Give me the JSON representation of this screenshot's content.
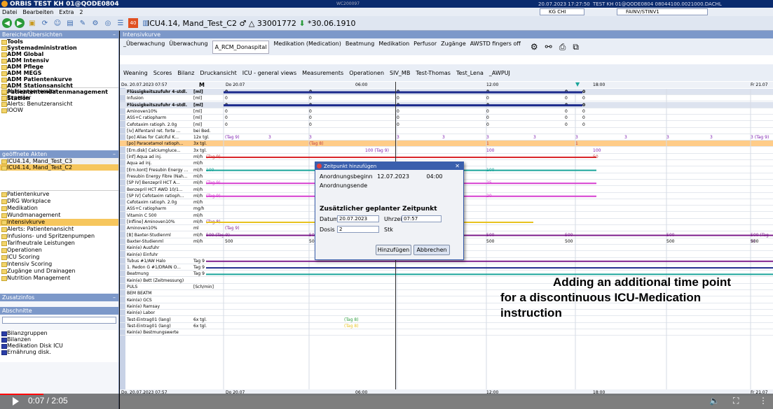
{
  "window": {
    "title": "ORBIS TEST KH 01@QODE0804",
    "center_text": "WC200097",
    "time": "20.07.2023 17:27:50",
    "right_text": "TEST KH 01@QODE0804 08044100.0021000.DACHL"
  },
  "menu": {
    "items": [
      "Datei",
      "Bearbeiten",
      "Extra",
      "2"
    ],
    "kg": "KG CHI",
    "fainv": "FAINV/STINV1"
  },
  "toolbar": {
    "patient": "ICU4.14, Mand_Test_C2",
    "patient_id": "33001772",
    "birth": "*30.06.1910"
  },
  "sidebar": {
    "section1_title": "Bereiche/Übersichten",
    "items1": [
      {
        "label": "Tools",
        "bold": true
      },
      {
        "label": "Systemadministration",
        "bold": true
      },
      {
        "label": "ADM Global",
        "bold": true
      },
      {
        "label": "ADM Intensiv",
        "bold": true
      },
      {
        "label": "ADM Pflege",
        "bold": true
      },
      {
        "label": "ADM MEGS",
        "bold": true
      },
      {
        "label": "ADM Patientenkurve",
        "bold": true
      },
      {
        "label": "ADM Stationsansicht",
        "bold": true
      },
      {
        "label": "Patiententendatenmanagement",
        "bold": true
      },
      {
        "label": "Station",
        "bold": true
      }
    ],
    "items1b": [
      "Abfragegenerator",
      "Experter",
      "Alerts: Benutzeransicht",
      "IOOW"
    ],
    "section2_title": "geöffnete Akten",
    "items2": [
      "ICU4.14, Mand_Test_C3",
      "ICU4.14, Mand_Test_C2"
    ],
    "items3": [
      "Patientenkurve",
      "DRG Workplace",
      "Medikation",
      "Wundmanagement",
      "Intensivkurve",
      "Alerts: Patientenansicht",
      "Infusions- und Spritzenpumpen",
      "Tarifneutrale Leistungen",
      "Operationen",
      "ICU Scoring",
      "Intensiv Scoring",
      "Zugänge und Drainagen",
      "Nutrition Management"
    ],
    "section3_title": "Zusatzinfos",
    "section4_title": "Abschnitte",
    "items4": [
      "Bilanzgruppen",
      "Bilanzen",
      "Medikation Disk ICU",
      "Ernährung disk."
    ]
  },
  "main": {
    "title": "Intensivkurve",
    "tabs1": [
      "_Überwachung",
      "Überwachung",
      "A_RCM_Donaspital",
      "Medikation (Medication)",
      "Beatmung",
      "Medikation",
      "Perfusor",
      "Zugänge",
      "AWSTD fingers off"
    ],
    "tabs1_active": 2,
    "tabs2": [
      "Weaning",
      "Scores",
      "Bilanz",
      "Druckansicht",
      "ICU - general views",
      "Measurements",
      "Operationen",
      "SIV_MB",
      "Test-Thomas",
      "Test_Lena",
      "_AWPUJ"
    ],
    "timeline_top": {
      "date": "Do. 20.07.2023 07:57",
      "m": "M",
      "d1": "Do 20.07",
      "t1": "06:00",
      "t2": "12:00",
      "t3": "18:00",
      "d2": "Fr 21.07"
    },
    "timeline_bot": {
      "date": "Do. 20.07.2023 07:57",
      "d1": "Do 20.07",
      "t1": "06:00",
      "t2": "12:00",
      "t3": "18:00",
      "d2": "Fr 21.07"
    },
    "rows": [
      {
        "label": "Flüssigkeitszufuhr 4-stdl.",
        "unit": "[ml]",
        "hdr": true
      },
      {
        "label": "Infusion",
        "unit": "[ml]"
      },
      {
        "label": "Flüssigkeitszufuhr 4-stdl.",
        "unit": "[ml]",
        "hdr": true
      },
      {
        "label": "Aminoven10%",
        "unit": "[ml]"
      },
      {
        "label": "ASS+C ratiopharm",
        "unit": "[ml]"
      },
      {
        "label": "Cefotaxim ratioph. 2.0g",
        "unit": "[ml]"
      },
      {
        "label": "[iv] Alfentanil ret. forte ...",
        "unit": "bei Bed."
      },
      {
        "label": "[po] Alias for Calciful K...",
        "unit": "12x tgl."
      },
      {
        "label": "[po] Paracetamol ratioph...",
        "unit": "3x tgl.",
        "orange": true
      },
      {
        "label": "[Ern.disk] Calciumgluce...",
        "unit": "3x tgl."
      },
      {
        "label": "[inf] Aqua ad inj.",
        "unit": "ml/h"
      },
      {
        "label": "Aqua ad inj.",
        "unit": "ml/h"
      },
      {
        "label": "[Ern.kont] Fresubin Energy ...",
        "unit": "ml/h"
      },
      {
        "label": "Fresubin Energy Fibre (Nah...",
        "unit": "ml/h"
      },
      {
        "label": "[SP IV] Benzepril HCT A...",
        "unit": "ml/h"
      },
      {
        "label": "Benzepril HCT AWD 10/1...",
        "unit": "ml/h"
      },
      {
        "label": "[SP IV] Cefotaxim ratioph...",
        "unit": "ml/h"
      },
      {
        "label": "Cefotaxim ratioph. 2.0g",
        "unit": "ml/h"
      },
      {
        "label": "ASS+C ratiopharm",
        "unit": "mg/h"
      },
      {
        "label": "Vitamin C 500",
        "unit": "ml/h"
      },
      {
        "label": "[Infline] Aminoven10%",
        "unit": "ml/h"
      },
      {
        "label": "Aminoven10%",
        "unit": "ml"
      },
      {
        "label": "[B] Baxter-Studienml",
        "unit": "ml/h"
      },
      {
        "label": "Baxter-Studienml",
        "unit": "ml/h"
      },
      {
        "label": "Kein(e) Ausfuhr",
        "unit": ""
      },
      {
        "label": "Kein(e) Einfuhr",
        "unit": ""
      },
      {
        "label": "Tubus #1/AW Halo",
        "unit": "Tag 9"
      },
      {
        "label": "1. Redon G #1/DRAIN O...",
        "unit": "Tag 9"
      },
      {
        "label": "Beatmung",
        "unit": "Tag 9"
      },
      {
        "label": "Kein(e) Bett (Zeitmessung)",
        "unit": ""
      },
      {
        "label": "PULS",
        "unit": "[Sch/min]"
      },
      {
        "label": "BEM BEATM",
        "unit": ""
      },
      {
        "label": "Kein(e) GCS",
        "unit": ""
      },
      {
        "label": "Kein(e) Ramsay",
        "unit": ""
      },
      {
        "label": "Kein(e) Labor",
        "unit": ""
      },
      {
        "label": "Test-Eintrag01 (lang)",
        "unit": "6x tgl."
      },
      {
        "label": "Test-Eintrag01 (lang)",
        "unit": "6x tgl."
      },
      {
        "label": "Kein(e) Bestmungswerte",
        "unit": ""
      }
    ],
    "values": {
      "zero": "0",
      "tag8": "(Tag 8)",
      "tag9": "(Tag 9)",
      "v100": "100",
      "v100tag9": "100 (Tag 9)",
      "v500": "500",
      "v500tag9": "500 (Tag 9)",
      "v3": "3",
      "v3tag9": "3 (Tag 9)",
      "v1": "1",
      "v50": "50",
      "v25": "25",
      "v20": "20"
    }
  },
  "dialog": {
    "title": "Zeitpunkt hinzufügen",
    "start_label": "Anordnungsbeginn",
    "start_date": "12.07.2023",
    "start_time": "04:00",
    "end_label": "Anordnungsende",
    "heading": "Zusätzlicher geplanter Zeitpunkt",
    "date_label": "Datum",
    "date_value": "20.07.2023",
    "time_label": "Uhrzeit",
    "time_value": "07:57",
    "dose_label": "Dosis",
    "dose_value": "2",
    "dose_unit": "Stk",
    "add_button": "Hinzufügen",
    "cancel_button": "Abbrechen"
  },
  "caption": {
    "line1": "Adding an additional time point",
    "line2": "for a discontinuous ICU-Medication",
    "line3": "instruction"
  },
  "video": {
    "time": "0:07 / 2:05",
    "progress": 0.056
  },
  "colors": {
    "titlebar": "#0a2b6e",
    "navy_bar": "#1c2a8c",
    "red_bar": "#d8262a",
    "teal_bar": "#1aa59a",
    "magenta_bar": "#d63fd0",
    "yellow_bar": "#e8c21f",
    "purple_bar": "#7d1f8c",
    "orange_row": "#ffcc88"
  }
}
